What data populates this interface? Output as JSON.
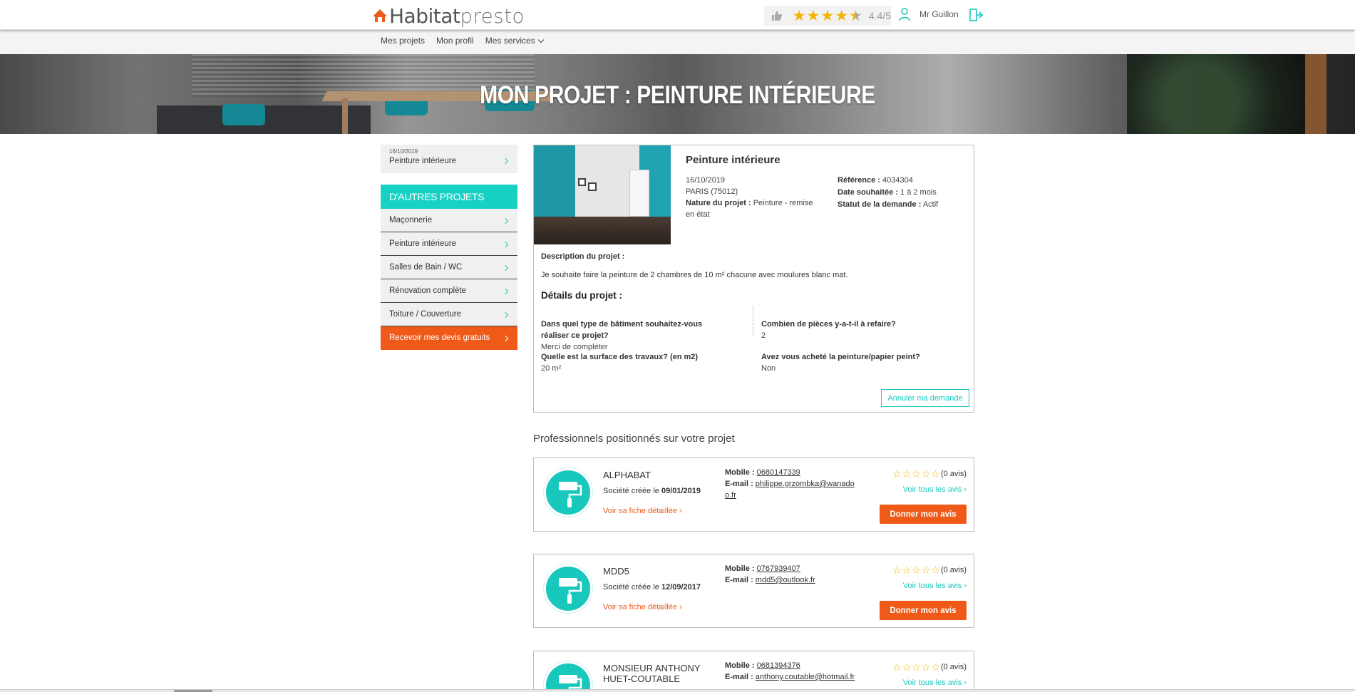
{
  "header": {
    "logo_part1": "Habitat",
    "logo_part2": "presto",
    "rating_value": "4.4/5",
    "rating": 4.4,
    "user_name": "Mr Guillon"
  },
  "nav": {
    "items": [
      "Mes projets",
      "Mon profil",
      "Mes services"
    ]
  },
  "hero": {
    "title": "MON PROJET : PEINTURE INTÉRIEURE"
  },
  "sidebar": {
    "current": {
      "date": "16/10/2019",
      "name": "Peinture intérieure"
    },
    "others_title": "D'AUTRES PROJETS",
    "items": [
      "Maçonnerie",
      "Peinture intérieure",
      "Salles de Bain / WC",
      "Rénovation complète",
      "Toiture / Couverture"
    ],
    "cta": "Recevoir mes devis gratuits"
  },
  "project": {
    "title": "Peinture intérieure",
    "date": "16/10/2019",
    "location": "PARIS (75012)",
    "nature_label": "Nature du projet :",
    "nature_value": "Peinture - remise en état",
    "reference_label": "Référence :",
    "reference_value": "4034304",
    "date_wished_label": "Date souhaitée :",
    "date_wished_value": "1 à 2 mois",
    "status_label": "Statut de la demande :",
    "status_value": "Actif",
    "description_label": "Description du projet :",
    "description_text": "Je souhaite faire la peinture de 2 chambres de 10 m² chacune avec moulures blanc mat.",
    "details_title": "Détails du projet :",
    "q1": {
      "question": "Dans quel type de bâtiment souhaitez-vous réaliser ce projet?",
      "answer": "Merci de compléter"
    },
    "q2": {
      "question": "Combien de pièces y-a-t-il à refaire?",
      "answer": "2"
    },
    "q3": {
      "question": "Quelle est la surface des travaux? (en m2)",
      "answer": "20 m²"
    },
    "q4": {
      "question": "Avez vous acheté la peinture/papier peint?",
      "answer": "Non"
    },
    "cancel_label": "Annuler ma demande"
  },
  "pros": {
    "title": "Professionnels positionnés sur votre projet",
    "mobile_label": "Mobile :",
    "email_label": "E-mail :",
    "since_label": "Société créée le",
    "detail_link": "Voir sa fiche détaillée ›",
    "all_reviews": "Voir tous les avis ›",
    "review_button": "Donner mon avis",
    "list": [
      {
        "name": "ALPHABAT",
        "since": "09/01/2019",
        "mobile": "0680147339",
        "email_1": "philippe.grzombka@wanado",
        "email_2": "o.fr",
        "reviews": "(0 avis)"
      },
      {
        "name": "MDD5",
        "since": "12/09/2017",
        "mobile": "0767939407",
        "email_1": "mdd5@outlook.fr",
        "email_2": "",
        "reviews": "(0 avis)"
      },
      {
        "name": "MONSIEUR ANTHONY HUET-COUTABLE",
        "since": "",
        "mobile": "0681394376",
        "email_1": "anthony.coutable@hotmail.fr",
        "email_2": "",
        "reviews": "(0 avis)"
      }
    ]
  },
  "colors": {
    "accent_teal": "#18d1c5",
    "accent_orange": "#f05a19",
    "star_yellow": "#f5b400"
  }
}
